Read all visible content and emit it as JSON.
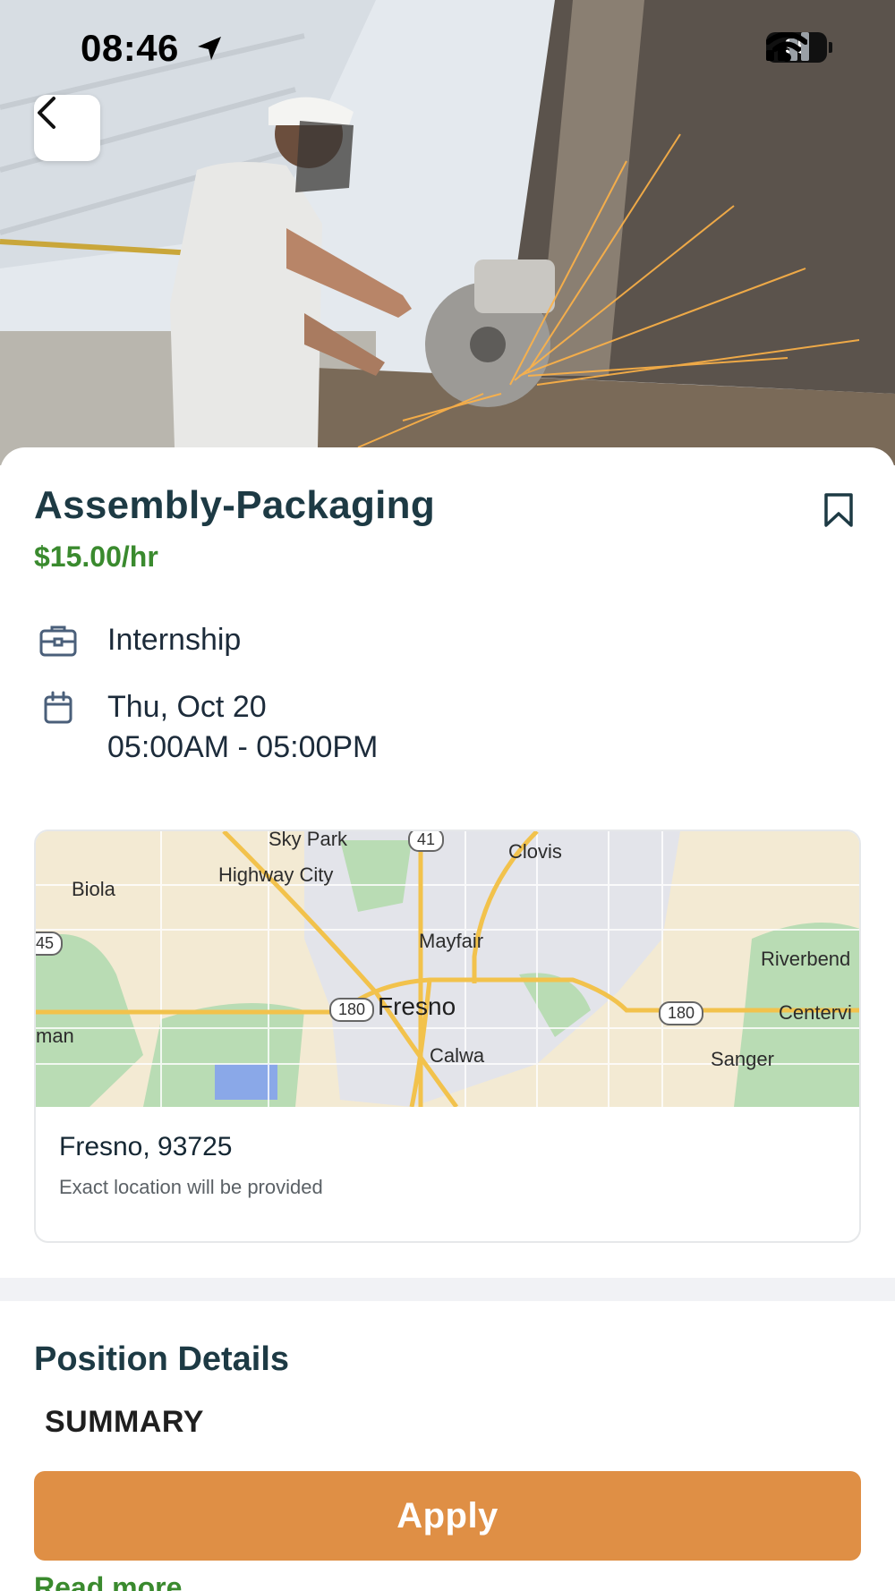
{
  "status_bar": {
    "time": "08:46",
    "battery": "95",
    "icons": [
      "location-arrow-icon",
      "signal-icon",
      "wifi-icon",
      "battery-icon"
    ]
  },
  "hero": {
    "image_description_icon": "hero-photo",
    "back_icon": "chevron-left-icon"
  },
  "job": {
    "title": "Assembly-Packaging",
    "pay": "$15.00/hr",
    "type": "Internship",
    "date": "Thu, Oct 20",
    "time_range": "05:00AM - 05:00PM",
    "bookmark_icon": "bookmark-icon"
  },
  "map": {
    "labels": {
      "sky_park": "Sky Park",
      "clovis": "Clovis",
      "biola": "Biola",
      "highway_city": "Highway City",
      "mayfair": "Mayfair",
      "riverbend": "Riverbend",
      "fresno": "Fresno",
      "centerville": "Centervi",
      "man": "man",
      "calwa": "Calwa",
      "sanger": "Sanger"
    },
    "shields": {
      "hwy41": "41",
      "hwy45": "45",
      "hwy180_west": "180",
      "hwy180_east": "180"
    }
  },
  "location": {
    "title": "Fresno, 93725",
    "note": "Exact location will be provided"
  },
  "details": {
    "section_title": "Position Details",
    "summary_heading": "SUMMARY",
    "apply_label": "Apply",
    "read_more": "Read more"
  },
  "colors": {
    "title": "#1d3a44",
    "pay_green": "#3a8a2e",
    "apply_orange": "#df8f45",
    "band_gray": "#f1f2f5"
  }
}
